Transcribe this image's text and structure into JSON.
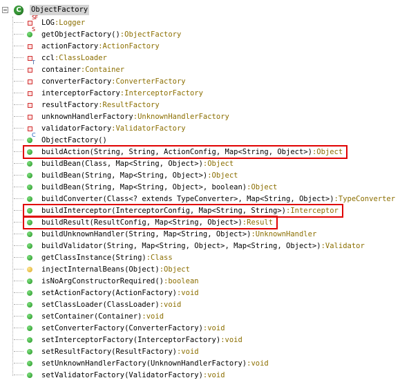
{
  "root": {
    "label": "ObjectFactory",
    "icon": "class-icon",
    "icon_letter": "C"
  },
  "members": [
    {
      "name": "LOG",
      "sep": " : ",
      "type": "Logger",
      "icon": "static-final-field-icon",
      "kind": "field-red",
      "mod": "SF"
    },
    {
      "name": "getObjectFactory()",
      "sep": " : ",
      "type": "ObjectFactory",
      "icon": "static-method-icon",
      "kind": "method-green",
      "mod": "S"
    },
    {
      "name": "actionFactory",
      "sep": " : ",
      "type": "ActionFactory",
      "icon": "private-field-icon",
      "kind": "field-red"
    },
    {
      "name": "ccl",
      "sep": " : ",
      "type": "ClassLoader",
      "icon": "transient-field-icon",
      "kind": "field-red",
      "mod_under": "T"
    },
    {
      "name": "container",
      "sep": " : ",
      "type": "Container",
      "icon": "private-field-icon",
      "kind": "field-red"
    },
    {
      "name": "converterFactory",
      "sep": " : ",
      "type": "ConverterFactory",
      "icon": "private-field-icon",
      "kind": "field-red"
    },
    {
      "name": "interceptorFactory",
      "sep": " : ",
      "type": "InterceptorFactory",
      "icon": "private-field-icon",
      "kind": "field-red"
    },
    {
      "name": "resultFactory",
      "sep": " : ",
      "type": "ResultFactory",
      "icon": "private-field-icon",
      "kind": "field-red"
    },
    {
      "name": "unknownHandlerFactory",
      "sep": " : ",
      "type": "UnknownHandlerFactory",
      "icon": "private-field-icon",
      "kind": "field-red"
    },
    {
      "name": "validatorFactory",
      "sep": " : ",
      "type": "ValidatorFactory",
      "icon": "private-field-icon",
      "kind": "field-red"
    },
    {
      "name": "ObjectFactory()",
      "sep": "",
      "type": "",
      "icon": "constructor-icon",
      "kind": "method-green",
      "mod": "C",
      "mod_color": "blue"
    },
    {
      "name": "buildAction(String, String, ActionConfig, Map<String, Object>)",
      "sep": " : ",
      "type": "Object",
      "icon": "public-method-icon",
      "kind": "method-green",
      "highlight": true
    },
    {
      "name": "buildBean(Class, Map<String, Object>)",
      "sep": " : ",
      "type": "Object",
      "icon": "public-method-icon",
      "kind": "method-green"
    },
    {
      "name": "buildBean(String, Map<String, Object>)",
      "sep": " : ",
      "type": "Object",
      "icon": "public-method-icon",
      "kind": "method-green"
    },
    {
      "name": "buildBean(String, Map<String, Object>, boolean)",
      "sep": " : ",
      "type": "Object",
      "icon": "public-method-icon",
      "kind": "method-green"
    },
    {
      "name": "buildConverter(Class<? extends TypeConverter>, Map<String, Object>)",
      "sep": " : ",
      "type": "TypeConverter",
      "icon": "public-method-icon",
      "kind": "method-green"
    },
    {
      "name": "buildInterceptor(InterceptorConfig, Map<String, String>)",
      "sep": " : ",
      "type": "Interceptor",
      "icon": "public-method-icon",
      "kind": "method-green",
      "highlight": true
    },
    {
      "name": "buildResult(ResultConfig, Map<String, Object>)",
      "sep": " : ",
      "type": "Result",
      "icon": "public-method-icon",
      "kind": "method-green",
      "highlight": true
    },
    {
      "name": "buildUnknownHandler(String, Map<String, Object>)",
      "sep": " : ",
      "type": "UnknownHandler",
      "icon": "public-method-icon",
      "kind": "method-green"
    },
    {
      "name": "buildValidator(String, Map<String, Object>, Map<String, Object>)",
      "sep": " : ",
      "type": "Validator",
      "icon": "public-method-icon",
      "kind": "method-green"
    },
    {
      "name": "getClassInstance(String)",
      "sep": " : ",
      "type": "Class",
      "icon": "public-method-icon",
      "kind": "method-green"
    },
    {
      "name": "injectInternalBeans(Object)",
      "sep": " : ",
      "type": "Object",
      "icon": "protected-method-icon",
      "kind": "method-gold"
    },
    {
      "name": "isNoArgConstructorRequired()",
      "sep": " : ",
      "type": "boolean",
      "icon": "public-method-icon",
      "kind": "method-green"
    },
    {
      "name": "setActionFactory(ActionFactory)",
      "sep": " : ",
      "type": "void",
      "icon": "public-method-icon",
      "kind": "method-green"
    },
    {
      "name": "setClassLoader(ClassLoader)",
      "sep": " : ",
      "type": "void",
      "icon": "public-method-icon",
      "kind": "method-green"
    },
    {
      "name": "setContainer(Container)",
      "sep": " : ",
      "type": "void",
      "icon": "public-method-icon",
      "kind": "method-green"
    },
    {
      "name": "setConverterFactory(ConverterFactory)",
      "sep": " : ",
      "type": "void",
      "icon": "public-method-icon",
      "kind": "method-green"
    },
    {
      "name": "setInterceptorFactory(InterceptorFactory)",
      "sep": " : ",
      "type": "void",
      "icon": "public-method-icon",
      "kind": "method-green"
    },
    {
      "name": "setResultFactory(ResultFactory)",
      "sep": " : ",
      "type": "void",
      "icon": "public-method-icon",
      "kind": "method-green"
    },
    {
      "name": "setUnknownHandlerFactory(UnknownHandlerFactory)",
      "sep": " : ",
      "type": "void",
      "icon": "public-method-icon",
      "kind": "method-green"
    },
    {
      "name": "setValidatorFactory(ValidatorFactory)",
      "sep": " : ",
      "type": "void",
      "icon": "public-method-icon",
      "kind": "method-green"
    }
  ],
  "colors": {
    "type_text": "#8b6e00",
    "highlight_border": "#e00000",
    "method_green": "#1f8f1f",
    "field_red": "#d03030",
    "protected_gold": "#d7a521"
  }
}
